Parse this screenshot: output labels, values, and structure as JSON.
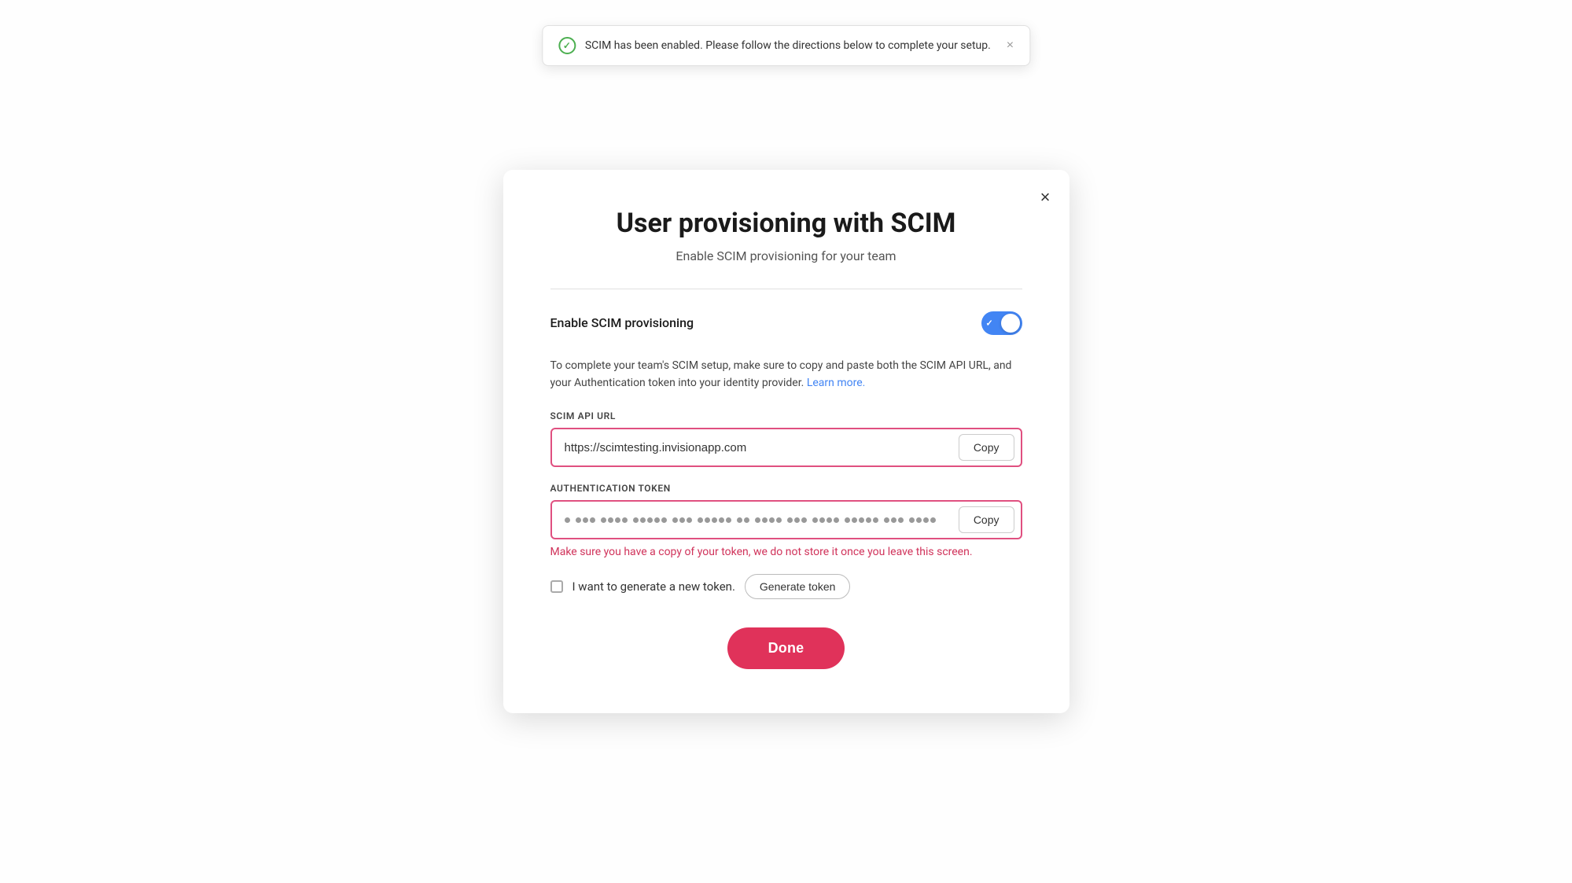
{
  "toast": {
    "message": "SCIM has been enabled. Please follow the directions below to complete your setup.",
    "close_label": "×",
    "icon": "check-circle-icon"
  },
  "close_button": "×",
  "modal": {
    "title": "User provisioning with SCIM",
    "subtitle": "Enable SCIM provisioning for your team",
    "toggle_label": "Enable SCIM provisioning",
    "toggle_enabled": true,
    "description": "To complete your team's SCIM setup, make sure to copy and paste both the SCIM API URL, and your Authentication token into your identity provider.",
    "learn_more_label": "Learn more.",
    "scim_api_url": {
      "label": "SCIM API URL",
      "value": "https://scimtesting.invisionapp.com",
      "copy_label": "Copy"
    },
    "auth_token": {
      "label": "Authentication token",
      "copy_label": "Copy",
      "warning": "Make sure you have a copy of your token, we do not store it once you leave this screen."
    },
    "new_token": {
      "checkbox_label": "I want to generate a new token.",
      "generate_label": "Generate token"
    },
    "done_label": "Done"
  }
}
